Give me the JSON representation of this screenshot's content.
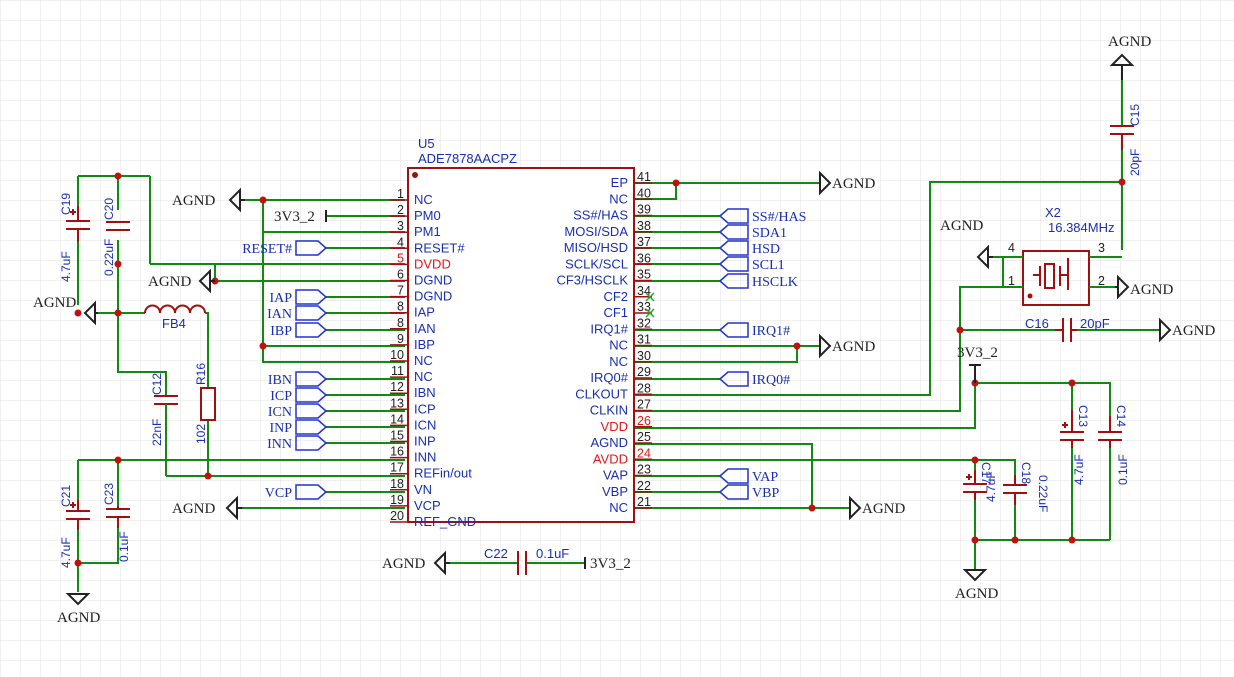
{
  "u5": {
    "designator": "U5",
    "part": "ADE7878AACPZ",
    "left_pins": [
      {
        "n": "1",
        "name": "NC"
      },
      {
        "n": "2",
        "name": "PM0"
      },
      {
        "n": "3",
        "name": "PM1"
      },
      {
        "n": "4",
        "name": "RESET#"
      },
      {
        "n": "5",
        "name": "DVDD",
        "red": true
      },
      {
        "n": "6",
        "name": "DGND"
      },
      {
        "n": "7",
        "name": "DGND"
      },
      {
        "n": "8",
        "name": "IAP"
      },
      {
        "n": "8",
        "name": "IAN"
      },
      {
        "n": "9",
        "name": "IBP"
      },
      {
        "n": "10",
        "name": "NC"
      },
      {
        "n": "11",
        "name": "NC"
      },
      {
        "n": "12",
        "name": "IBN"
      },
      {
        "n": "13",
        "name": "ICP"
      },
      {
        "n": "14",
        "name": "ICN"
      },
      {
        "n": "15",
        "name": "INP"
      },
      {
        "n": "16",
        "name": "INN"
      },
      {
        "n": "17",
        "name": "REFin/out"
      },
      {
        "n": "18",
        "name": "VN"
      },
      {
        "n": "19",
        "name": "VCP"
      },
      {
        "n": "20",
        "name": "REF_GND"
      }
    ],
    "right_pins": [
      {
        "n": "41",
        "name": "EP"
      },
      {
        "n": "40",
        "name": "NC"
      },
      {
        "n": "39",
        "name": "SS#/HAS"
      },
      {
        "n": "38",
        "name": "MOSI/SDA"
      },
      {
        "n": "37",
        "name": "MISO/HSD"
      },
      {
        "n": "36",
        "name": "SCLK/SCL"
      },
      {
        "n": "35",
        "name": "CF3/HSCLK"
      },
      {
        "n": "34",
        "name": "CF2"
      },
      {
        "n": "33",
        "name": "CF1"
      },
      {
        "n": "32",
        "name": "IRQ1#"
      },
      {
        "n": "31",
        "name": "NC"
      },
      {
        "n": "30",
        "name": "NC"
      },
      {
        "n": "29",
        "name": "IRQ0#"
      },
      {
        "n": "28",
        "name": "CLKOUT"
      },
      {
        "n": "27",
        "name": "CLKIN"
      },
      {
        "n": "26",
        "name": "VDD",
        "red": true
      },
      {
        "n": "25",
        "name": "AGND"
      },
      {
        "n": "24",
        "name": "AVDD",
        "red": true
      },
      {
        "n": "23",
        "name": "VAP"
      },
      {
        "n": "22",
        "name": "VBP"
      },
      {
        "n": "21",
        "name": "NC"
      }
    ]
  },
  "left_ports": [
    "RESET#",
    "IAP",
    "IAN",
    "IBP",
    "IBN",
    "ICP",
    "ICN",
    "INP",
    "INN",
    "VCP"
  ],
  "right_ports": [
    "SS#/HAS",
    "SDA1",
    "HSD",
    "SCL1",
    "HSCLK",
    "IRQ1#",
    "IRQ0#",
    "VAP",
    "VBP"
  ],
  "net_labels": {
    "agnd": "AGND",
    "v33": "3V3_2"
  },
  "crystal": {
    "designator": "X2",
    "value": "16.384MHz",
    "pins": [
      "1",
      "2",
      "3",
      "4"
    ]
  },
  "components": [
    {
      "ref": "C19",
      "value": "4.7uF"
    },
    {
      "ref": "C20",
      "value": "0.22uF"
    },
    {
      "ref": "FB4",
      "value": ""
    },
    {
      "ref": "C12",
      "value": "22nF"
    },
    {
      "ref": "R16",
      "value": "102"
    },
    {
      "ref": "C21",
      "value": "4.7uF"
    },
    {
      "ref": "C23",
      "value": "0.1uF"
    },
    {
      "ref": "C22",
      "value": "0.1uF"
    },
    {
      "ref": "C15",
      "value": "20pF"
    },
    {
      "ref": "C16",
      "value": "20pF"
    },
    {
      "ref": "C17",
      "value": "4.7uF"
    },
    {
      "ref": "C18",
      "value": "0.22uF"
    },
    {
      "ref": "C13",
      "value": "4.7uF"
    },
    {
      "ref": "C14",
      "value": "0.1uF"
    }
  ],
  "colors": {
    "wire": "#118a11",
    "part": "#a01010",
    "label": "#1a2fb0",
    "power_pin": "#e01818",
    "grid": "#dcdcdc"
  }
}
